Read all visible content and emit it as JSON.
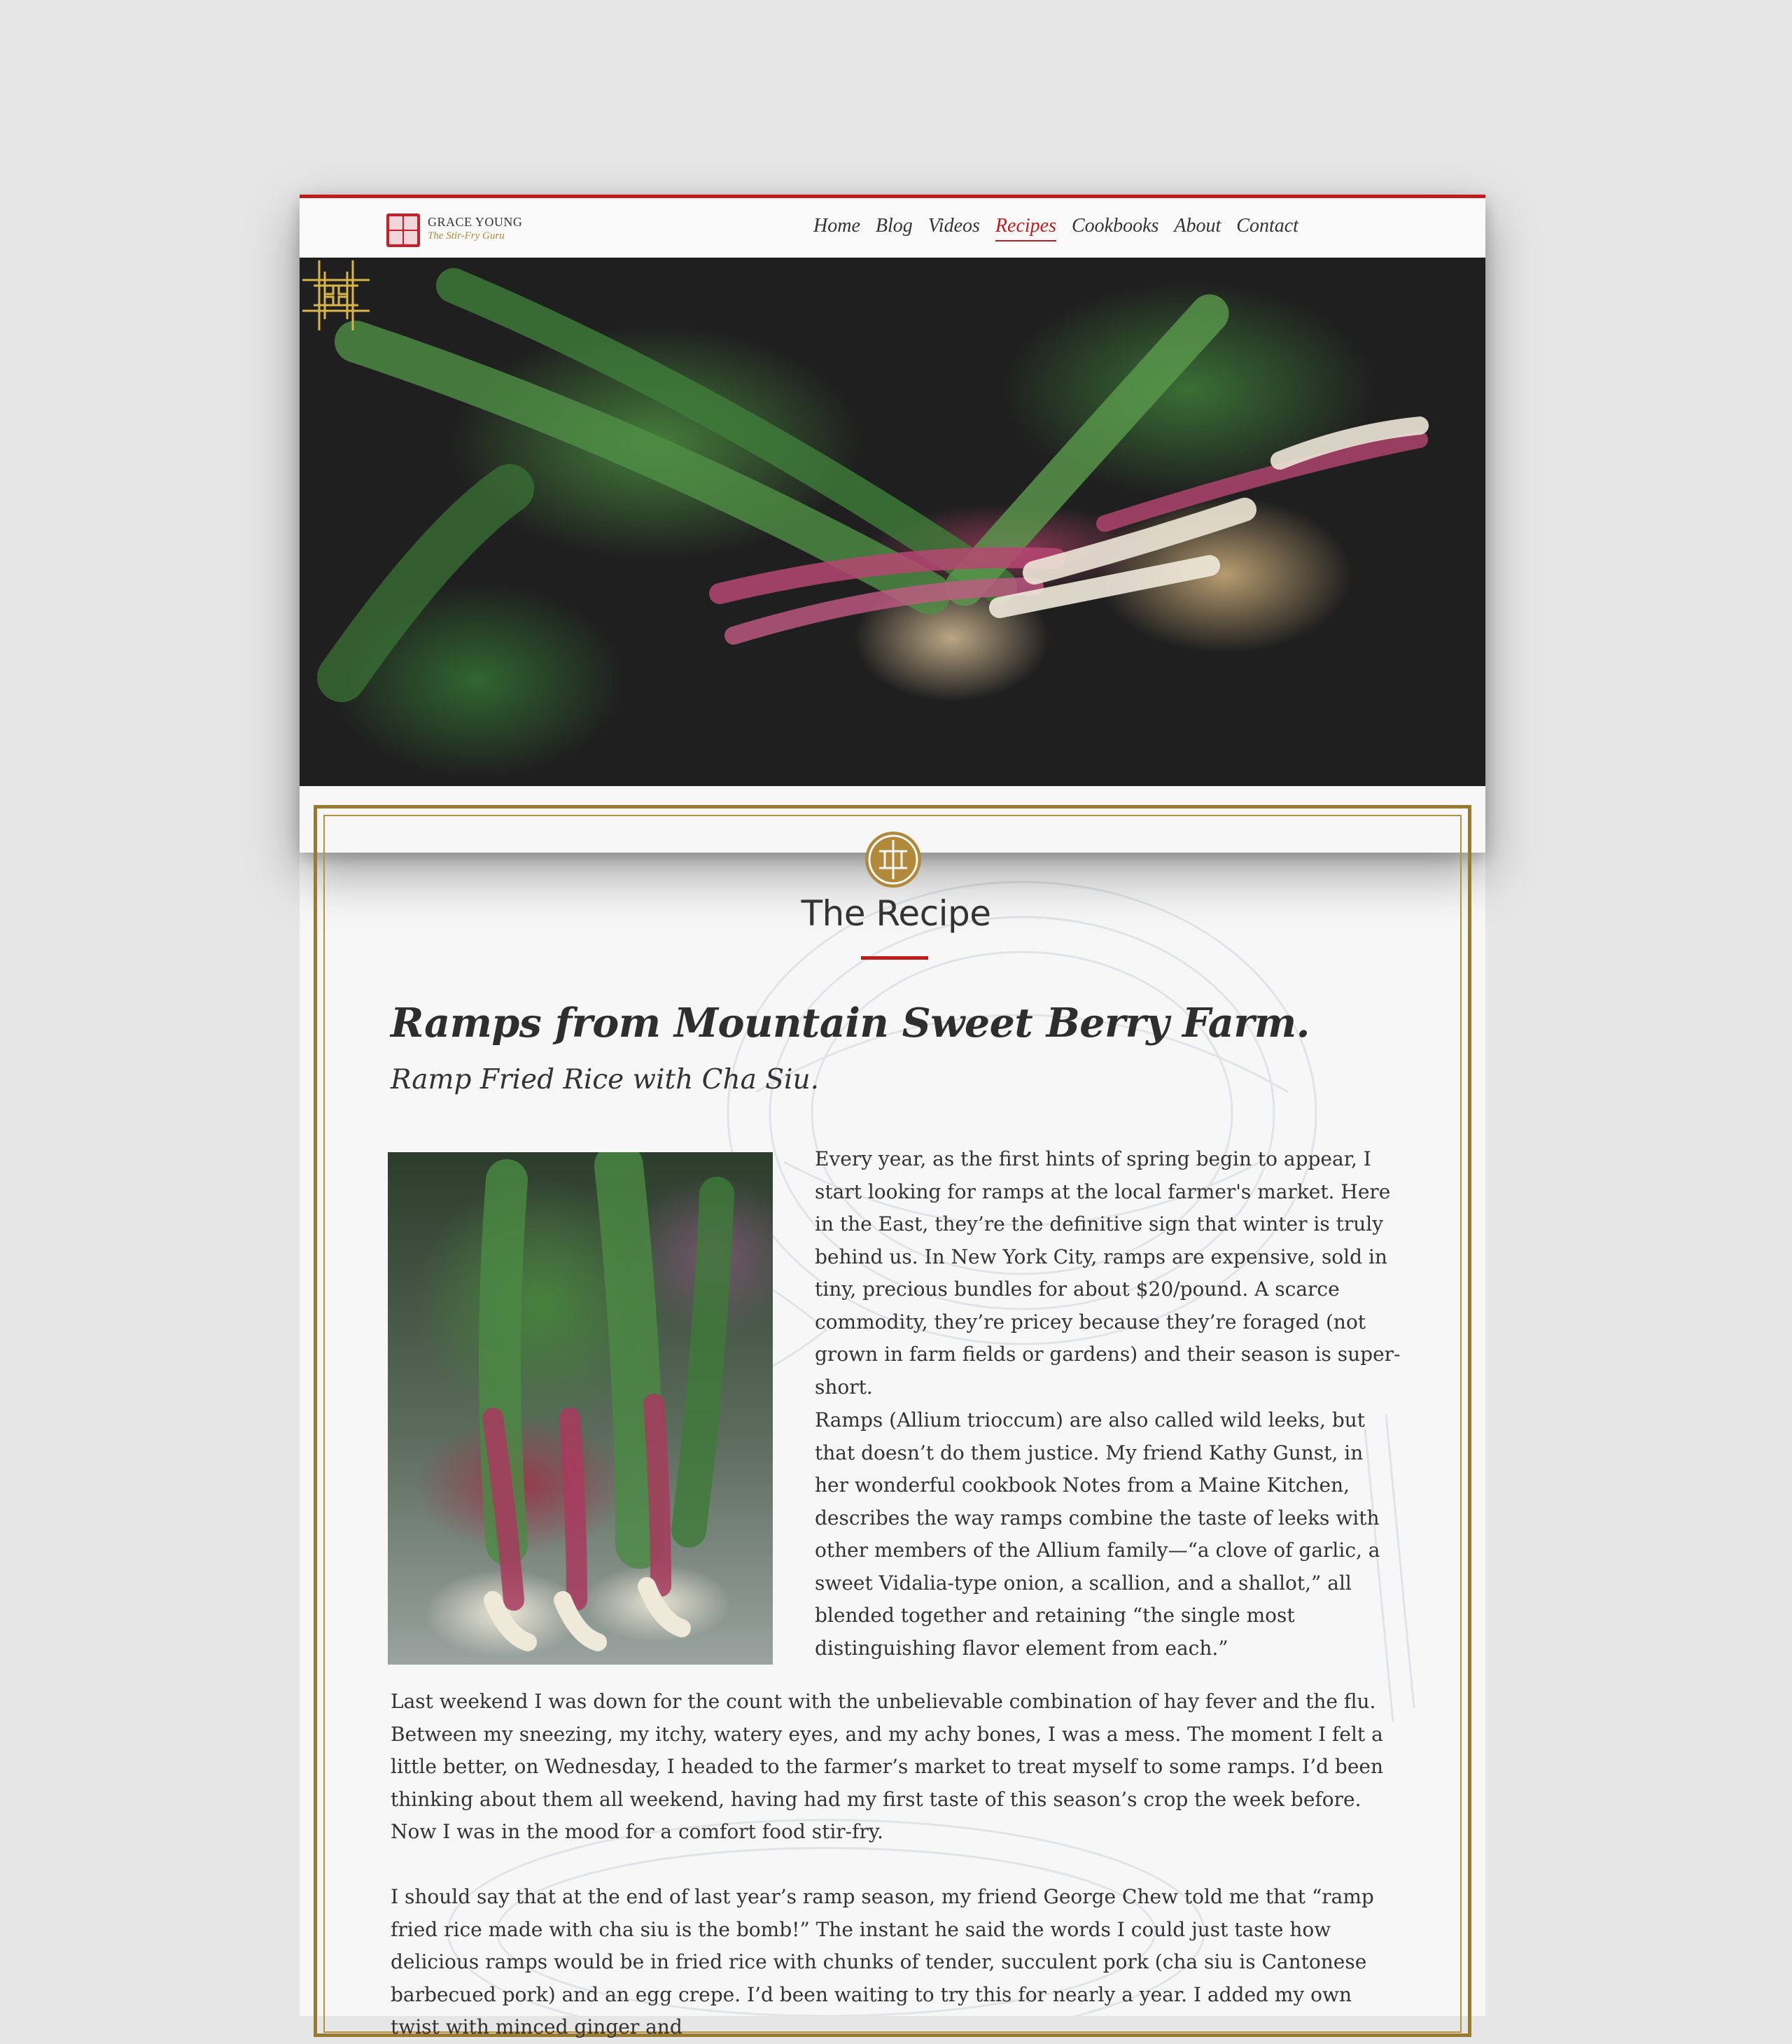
{
  "brand": {
    "name": "GRACE YOUNG",
    "tagline": "The Stir-Fry Guru"
  },
  "nav": {
    "items": [
      {
        "label": "Home"
      },
      {
        "label": "Blog"
      },
      {
        "label": "Videos"
      },
      {
        "label": "Recipes",
        "active": true
      },
      {
        "label": "Cookbooks"
      },
      {
        "label": "About"
      },
      {
        "label": "Contact"
      }
    ]
  },
  "colors": {
    "accent_red": "#c21b1b",
    "gold": "#9a7a2e",
    "background": "#e6e6e6"
  },
  "section": {
    "title": "The Recipe"
  },
  "article": {
    "title": "Ramps from Mountain Sweet Berry Farm.",
    "subtitle": "Ramp Fried Rice with Cha Siu.",
    "paragraphs": [
      "Every year, as the first hints of spring begin to appear,   I start looking for ramps at the local farmer's market. Here in the East, they’re the definitive sign that winter is truly behind us. In New York City, ramps are expensive, sold in tiny, precious bundles for about $20/pound. A scarce commodity, they’re pricey because they’re foraged (not grown in farm fields or gardens) and their season is super-short.",
      "Ramps (Allium trioccum) are also called wild leeks, but that doesn’t do them justice. My friend Kathy Gunst, in her wonderful cookbook Notes from a Maine Kitchen, describes the way ramps combine the taste of leeks with other members of the Allium family—“a clove of garlic, a sweet Vidalia-type onion, a scallion, and a shallot,” all blended together and retaining “the single most distinguishing flavor element from each.”",
      "Last weekend I was down for the count with the unbelievable combination of hay fever and the flu. Between my sneezing, my itchy, watery eyes, and my achy bones, I was a mess. The moment I felt a little better, on Wednesday, I headed to the farmer’s market to treat myself to some ramps. I’d been thinking about them all weekend, having had my first taste of this season’s crop the week before. Now I was in the mood for a comfort food stir-fry.",
      "I should say that at the end of last year’s ramp season, my friend George Chew told me that “ramp fried rice made with cha siu is the bomb!” The instant he said the words I could just taste how delicious ramps would be in fried rice with chunks of tender, succulent pork (cha siu is Cantonese barbecued pork) and an egg crepe. I’d been waiting to try this for nearly a year. I added my own twist with minced ginger and"
    ]
  },
  "icons": {
    "logo": "chinese-seal-icon",
    "medallion": "shou-medallion-icon",
    "frame": "fretwork-corner-icon"
  }
}
